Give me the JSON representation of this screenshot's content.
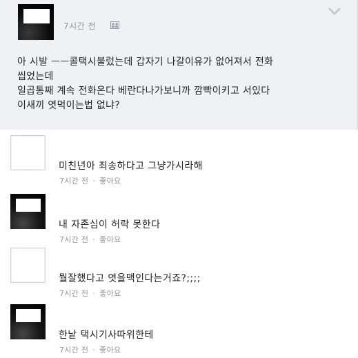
{
  "post": {
    "time": "7시간 전",
    "privacy_icon": "friends-icon",
    "menu_icon": "chevron-down-icon",
    "body_lines": [
      "아 시발 ㅡㅡ콜택시불렀는데 갑자기 나갈이유가 없어져서 전화",
      "씹었는데",
      "일곱통째 계속 전화온다 베란다나가보니까 깜빡이키고 서있다",
      "이새끼 엿먹이는법 없냐?"
    ]
  },
  "comments": [
    {
      "text": "미친년아 죄송하다고 그냥가시라해",
      "time": "7시간 전",
      "like": "좋아요"
    },
    {
      "text": "내 자존심이 허락 못한다",
      "time": "7시간 전",
      "like": "좋아요"
    },
    {
      "text": "뭘잘했다고 엿을맥인다는거죠?;;;;",
      "time": "7시간 전",
      "like": "좋아요"
    },
    {
      "text": "한낱 택시기사따위한테",
      "time": "7시간 전",
      "like": "좋아요"
    }
  ],
  "dot": "·"
}
